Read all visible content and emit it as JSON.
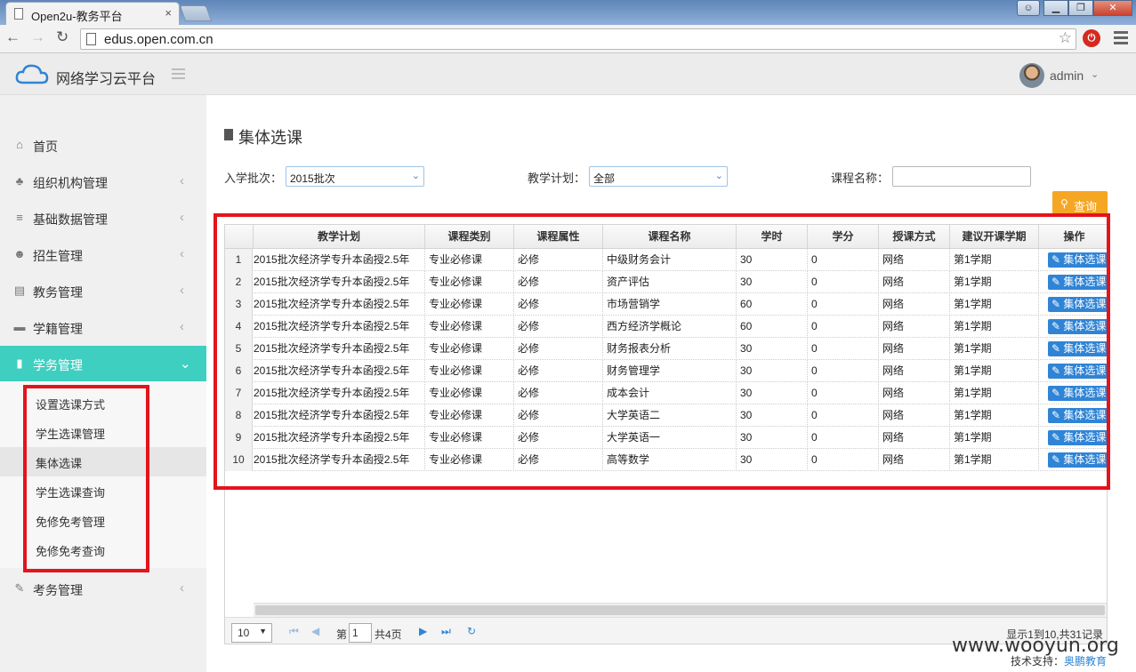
{
  "browser": {
    "tab_title": "Open2u-教务平台",
    "tab_close": "×",
    "url": "edus.open.com.cn"
  },
  "header": {
    "app_name": "网络学习云平台",
    "user": "admin"
  },
  "sidebar": {
    "items": [
      {
        "label": "首页",
        "icon": "home-icon",
        "glyph": "⌂"
      },
      {
        "label": "组织机构管理",
        "icon": "sitemap-icon",
        "glyph": "♣"
      },
      {
        "label": "基础数据管理",
        "icon": "database-icon",
        "glyph": "≡"
      },
      {
        "label": "招生管理",
        "icon": "users-icon",
        "glyph": "☻"
      },
      {
        "label": "教务管理",
        "icon": "list-icon",
        "glyph": "▤"
      },
      {
        "label": "学籍管理",
        "icon": "folder-icon",
        "glyph": "▬"
      },
      {
        "label": "学务管理",
        "icon": "file-icon",
        "glyph": "▮"
      }
    ],
    "submenu": [
      "设置选课方式",
      "学生选课管理",
      "集体选课",
      "学生选课查询",
      "免修免考管理",
      "免修免考查询"
    ],
    "last_item": {
      "label": "考务管理",
      "icon": "edit-icon",
      "glyph": "✎"
    },
    "active_color": "#3fcfc0"
  },
  "main": {
    "title": "集体选课",
    "filters": {
      "batch_label": "入学批次：",
      "batch_value": "2015批次",
      "plan_label": "教学计划：",
      "plan_value": "全部",
      "course_label": "课程名称："
    },
    "query_button": "查询",
    "columns": [
      "教学计划",
      "课程类别",
      "课程属性",
      "课程名称",
      "学时",
      "学分",
      "授课方式",
      "建议开课学期",
      "操作"
    ],
    "rows": [
      {
        "n": "1",
        "plan": "2015批次经济学专升本函授2.5年",
        "type": "专业必修课",
        "attr": "必修",
        "name": "中级财务会计",
        "hours": "30",
        "credit": "0",
        "mode": "网络",
        "term": "第1学期",
        "action": "集体选课"
      },
      {
        "n": "2",
        "plan": "2015批次经济学专升本函授2.5年",
        "type": "专业必修课",
        "attr": "必修",
        "name": "资产评估",
        "hours": "30",
        "credit": "0",
        "mode": "网络",
        "term": "第1学期",
        "action": "集体选课"
      },
      {
        "n": "3",
        "plan": "2015批次经济学专升本函授2.5年",
        "type": "专业必修课",
        "attr": "必修",
        "name": "市场营销学",
        "hours": "60",
        "credit": "0",
        "mode": "网络",
        "term": "第1学期",
        "action": "集体选课"
      },
      {
        "n": "4",
        "plan": "2015批次经济学专升本函授2.5年",
        "type": "专业必修课",
        "attr": "必修",
        "name": "西方经济学概论",
        "hours": "60",
        "credit": "0",
        "mode": "网络",
        "term": "第1学期",
        "action": "集体选课"
      },
      {
        "n": "5",
        "plan": "2015批次经济学专升本函授2.5年",
        "type": "专业必修课",
        "attr": "必修",
        "name": "财务报表分析",
        "hours": "30",
        "credit": "0",
        "mode": "网络",
        "term": "第1学期",
        "action": "集体选课"
      },
      {
        "n": "6",
        "plan": "2015批次经济学专升本函授2.5年",
        "type": "专业必修课",
        "attr": "必修",
        "name": "财务管理学",
        "hours": "30",
        "credit": "0",
        "mode": "网络",
        "term": "第1学期",
        "action": "集体选课"
      },
      {
        "n": "7",
        "plan": "2015批次经济学专升本函授2.5年",
        "type": "专业必修课",
        "attr": "必修",
        "name": "成本会计",
        "hours": "30",
        "credit": "0",
        "mode": "网络",
        "term": "第1学期",
        "action": "集体选课"
      },
      {
        "n": "8",
        "plan": "2015批次经济学专升本函授2.5年",
        "type": "专业必修课",
        "attr": "必修",
        "name": "大学英语二",
        "hours": "30",
        "credit": "0",
        "mode": "网络",
        "term": "第1学期",
        "action": "集体选课"
      },
      {
        "n": "9",
        "plan": "2015批次经济学专升本函授2.5年",
        "type": "专业必修课",
        "attr": "必修",
        "name": "大学英语一",
        "hours": "30",
        "credit": "0",
        "mode": "网络",
        "term": "第1学期",
        "action": "集体选课"
      },
      {
        "n": "10",
        "plan": "2015批次经济学专升本函授2.5年",
        "type": "专业必修课",
        "attr": "必修",
        "name": "高等数学",
        "hours": "30",
        "credit": "0",
        "mode": "网络",
        "term": "第1学期",
        "action": "集体选课"
      }
    ],
    "pager": {
      "page_size": "10",
      "page_prefix": "第",
      "page": "1",
      "total_pages": "共4页",
      "info": "显示1到10,共31记录"
    }
  },
  "footer": {
    "support_label": "技术支持：",
    "support_link": "奥鹏教育"
  },
  "watermark": "www.wooyun.org"
}
